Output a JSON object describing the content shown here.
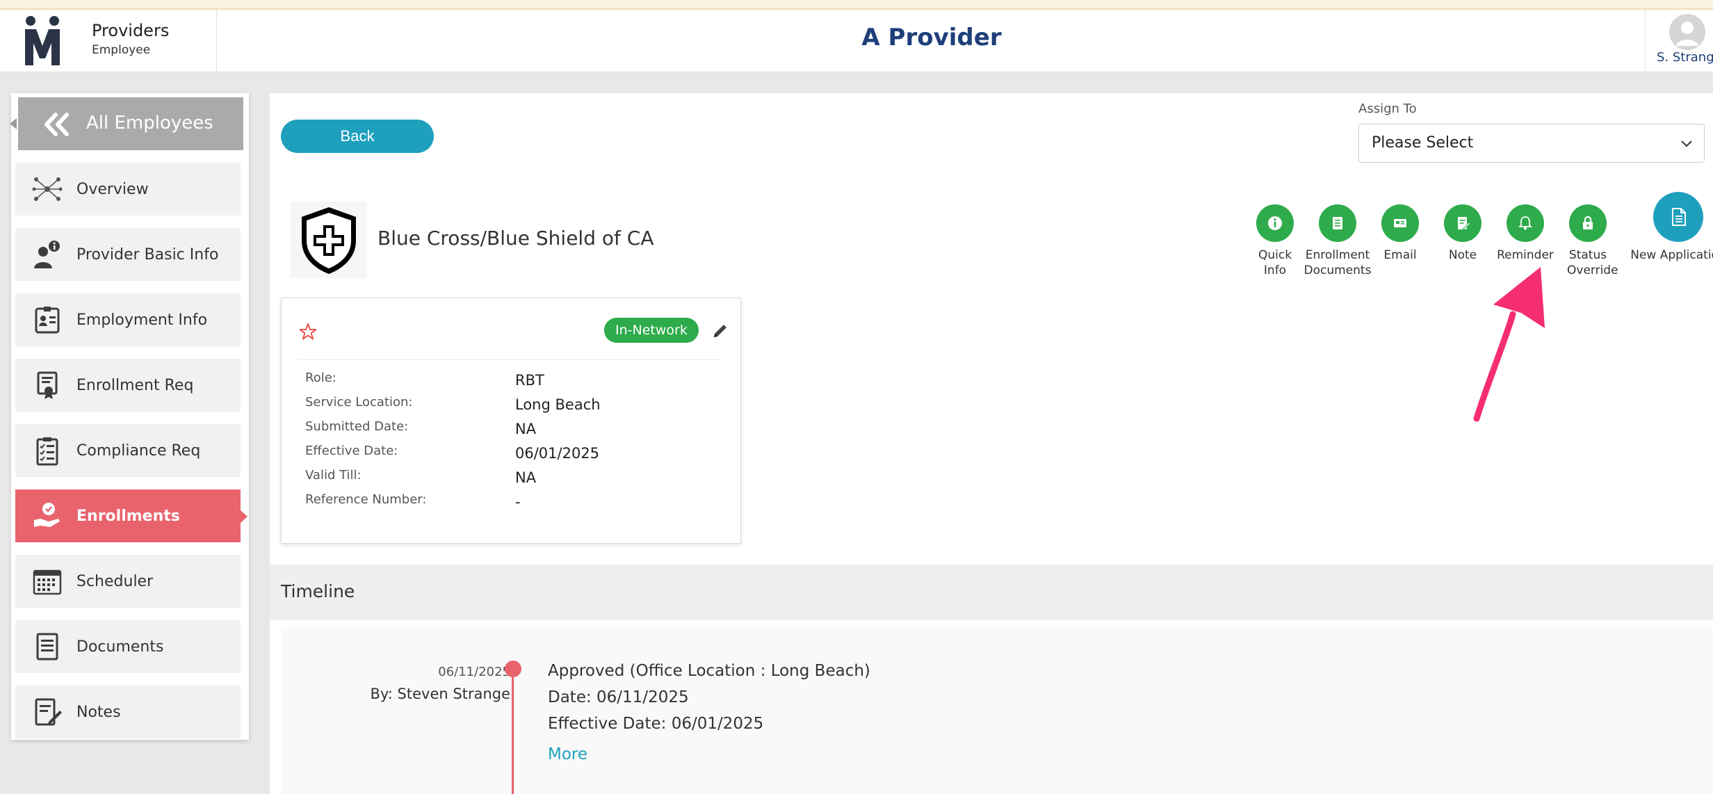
{
  "header": {
    "app_name": "Providers",
    "app_role": "Employee",
    "page_title": "A Provider",
    "user_name": "S. Strange"
  },
  "sidebar": {
    "back_label": "All Employees",
    "items": [
      {
        "label": "Overview",
        "icon": "network-icon"
      },
      {
        "label": "Provider Basic Info",
        "icon": "user-info-icon"
      },
      {
        "label": "Employment Info",
        "icon": "id-card-icon"
      },
      {
        "label": "Enrollment Req",
        "icon": "certificate-icon"
      },
      {
        "label": "Compliance Req",
        "icon": "clipboard-checklist-icon"
      },
      {
        "label": "Enrollments",
        "icon": "hand-check-icon",
        "active": true
      },
      {
        "label": "Scheduler",
        "icon": "calendar-icon"
      },
      {
        "label": "Documents",
        "icon": "document-icon"
      },
      {
        "label": "Notes",
        "icon": "note-edit-icon"
      }
    ]
  },
  "main": {
    "back_button": "Back",
    "assign_to": {
      "label": "Assign To",
      "value": "Please Select"
    },
    "payer_name": "Blue Cross/Blue Shield of CA",
    "actions": [
      {
        "label": "Quick Info",
        "icon": "info-icon"
      },
      {
        "label": "Enrollment Documents",
        "icon": "document-list-icon"
      },
      {
        "label": "Email",
        "icon": "email-card-icon"
      },
      {
        "label": "Note",
        "icon": "note-icon"
      },
      {
        "label": "Reminder",
        "icon": "bell-icon"
      },
      {
        "label": "Status Override",
        "icon": "lock-icon"
      },
      {
        "label": "New Application",
        "icon": "new-document-icon"
      }
    ],
    "card": {
      "status_badge": "In-Network",
      "fields": [
        {
          "label": "Role:",
          "value": "RBT"
        },
        {
          "label": "Service Location:",
          "value": "Long Beach"
        },
        {
          "label": "Submitted Date:",
          "value": "NA"
        },
        {
          "label": "Effective Date:",
          "value": "06/01/2025"
        },
        {
          "label": "Valid Till:",
          "value": "NA"
        },
        {
          "label": "Reference Number:",
          "value": "-"
        }
      ]
    },
    "timeline": {
      "title": "Timeline",
      "entries": [
        {
          "date": "06/11/2025",
          "by": "By: Steven Strange",
          "heading": "Approved (Office Location : Long Beach)",
          "line1": "Date: 06/11/2025",
          "line2": "Effective Date: 06/01/2025",
          "more": "More"
        }
      ]
    }
  },
  "colors": {
    "accent_teal": "#1ea0bd",
    "action_green": "#2eab4a",
    "active_red": "#e8636c",
    "title_navy": "#1f3f7a",
    "annotation_pink": "#f52d72"
  }
}
